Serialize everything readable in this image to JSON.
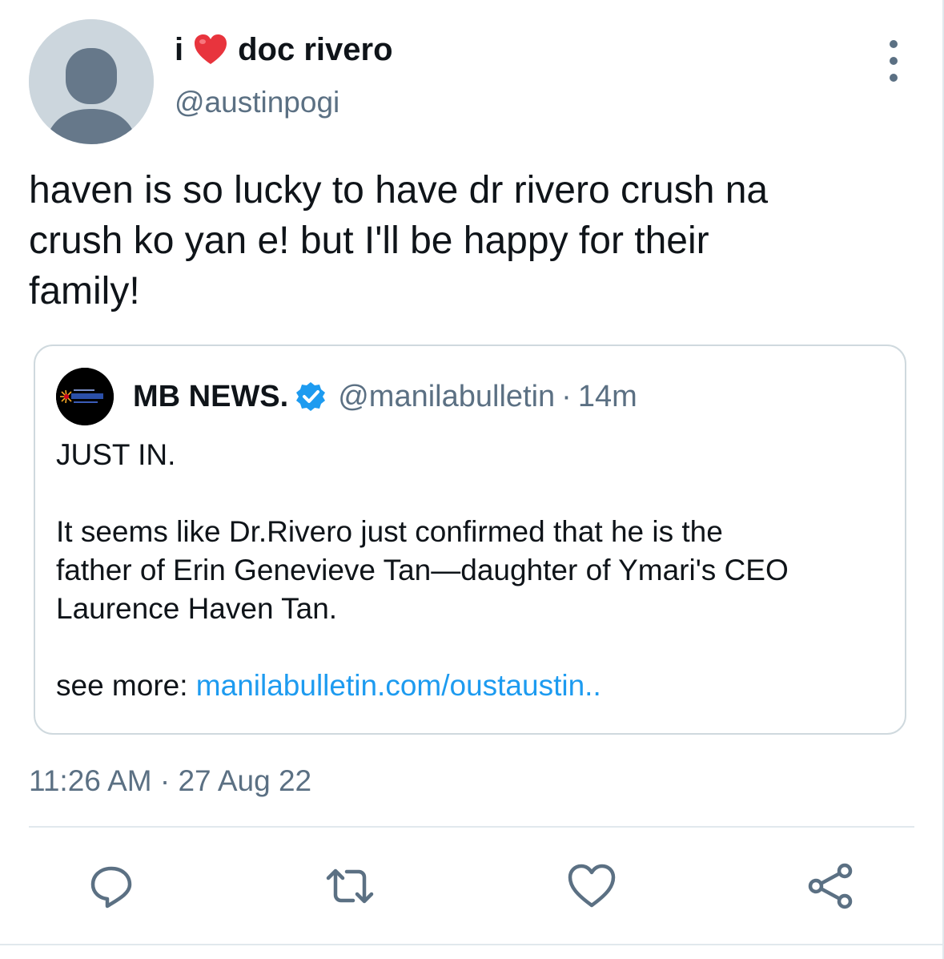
{
  "tweet": {
    "display_name_prefix": "i",
    "display_name_suffix": "doc rivero",
    "handle": "@austinpogi",
    "text": "haven is so lucky to have dr rivero crush na\ncrush ko yan e! but I'll be happy for their\nfamily!",
    "timestamp": "11:26 AM · 27 Aug 22"
  },
  "quote": {
    "name": "MB NEWS.",
    "handle": "@manilabulletin",
    "separator": "·",
    "time": "14m",
    "line1": "JUST IN.",
    "line2": "It seems like Dr.Rivero just confirmed that he is the\nfather of Erin Genevieve Tan—daughter of Ymari's CEO\nLaurence Haven Tan.",
    "see_more_label": "see more: ",
    "link_text": "manilabulletin.com/oustaustin.."
  },
  "icons": {
    "name_emoji": "red-heart-icon",
    "verified": "verified-badge-icon",
    "more": "more-vertical-icon",
    "reply": "reply-icon",
    "retweet": "retweet-icon",
    "like": "like-icon",
    "share": "share-icon"
  },
  "colors": {
    "secondary_text": "#5b7083",
    "link": "#1d9bf0",
    "verified": "#1d9bf0",
    "heart": "#e0245e",
    "border": "#cfd9de"
  }
}
